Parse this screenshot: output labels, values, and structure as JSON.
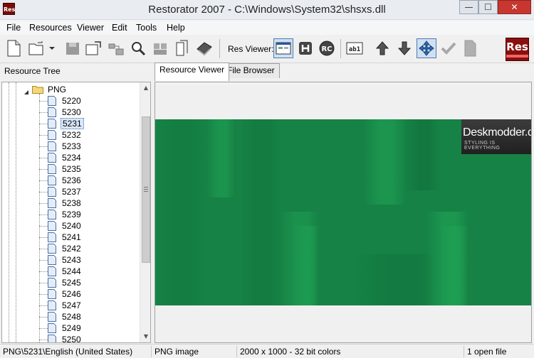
{
  "window": {
    "app_icon_text": "Res",
    "title": "Restorator 2007 - C:\\Windows\\System32\\shsxs.dll",
    "minimize_glyph": "—",
    "maximize_glyph": "☐",
    "close_glyph": "✕"
  },
  "menu": {
    "items": [
      "File",
      "Resources",
      "Viewer",
      "Edit",
      "Tools",
      "Help"
    ]
  },
  "toolbar": {
    "res_viewer_label": "Res Viewer:",
    "logo_text": "Res",
    "icons": [
      "new-file-icon",
      "open-file-icon",
      "open-dropdown-icon",
      "save-icon",
      "export-icon",
      "move-icon",
      "find-icon",
      "copy-block-icon",
      "copy-pages-icon",
      "resource-book-icon",
      "view-ui-icon",
      "view-hex-icon",
      "view-rc-icon",
      "view-binary-icon",
      "move-up-icon",
      "move-down-icon",
      "center-view-icon",
      "check-icon",
      "document-icon"
    ]
  },
  "left_panel": {
    "header": "Resource Tree",
    "folder_label": "PNG",
    "items": [
      "5220",
      "5230",
      "5231",
      "5232",
      "5233",
      "5234",
      "5235",
      "5236",
      "5237",
      "5238",
      "5239",
      "5240",
      "5241",
      "5242",
      "5243",
      "5244",
      "5245",
      "5246",
      "5247",
      "5248",
      "5249",
      "5250"
    ],
    "selected": "5231"
  },
  "tabs": [
    "Resource Viewer",
    "File Browser"
  ],
  "active_tab": "Resource Viewer",
  "viewer": {
    "image_colors": {
      "base": "#168245",
      "light": "#1fa255",
      "dark": "#0f6e3a"
    },
    "watermark": {
      "title": "Deskmodder.de",
      "subtitle": "STYLING IS EVERYTHING"
    }
  },
  "status": {
    "path": "PNG\\5231\\English (United States)",
    "type": "PNG image",
    "dimensions": "2000 x 1000 - 32 bit colors",
    "open_files": "1 open file"
  },
  "colors": {
    "accent": "#3d6fb0",
    "logo_red": "#8a0e0e",
    "close_red": "#c7372f"
  }
}
